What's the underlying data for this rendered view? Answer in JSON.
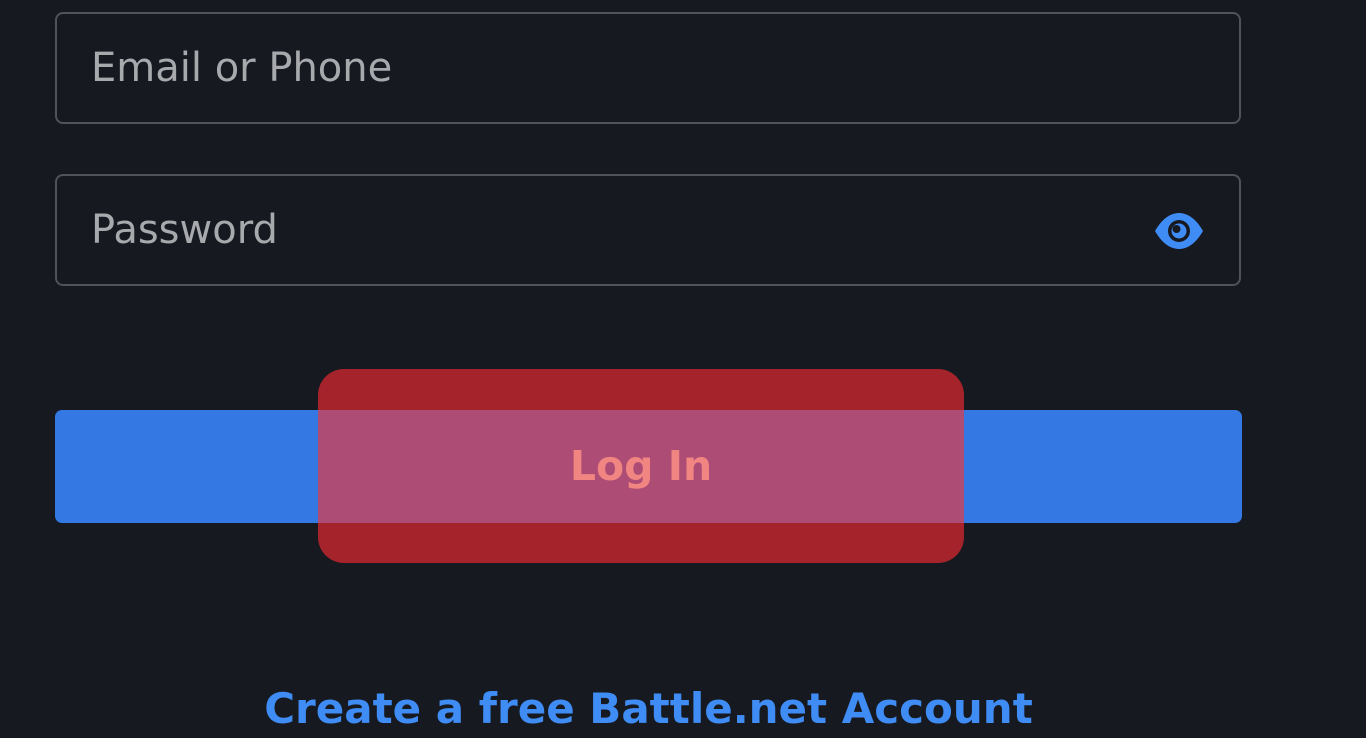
{
  "form": {
    "email_placeholder": "Email or Phone",
    "email_value": "",
    "password_placeholder": "Password",
    "password_value": "",
    "login_label": "Log In",
    "create_account_label": "Create a free Battle.net Account"
  },
  "icons": {
    "password_toggle": "eye-icon"
  },
  "colors": {
    "background": "#171920",
    "field_border": "#4f5258",
    "primary_button": "#3478e4",
    "link": "#3f8cf5",
    "highlight_overlay": "#a5232a"
  }
}
